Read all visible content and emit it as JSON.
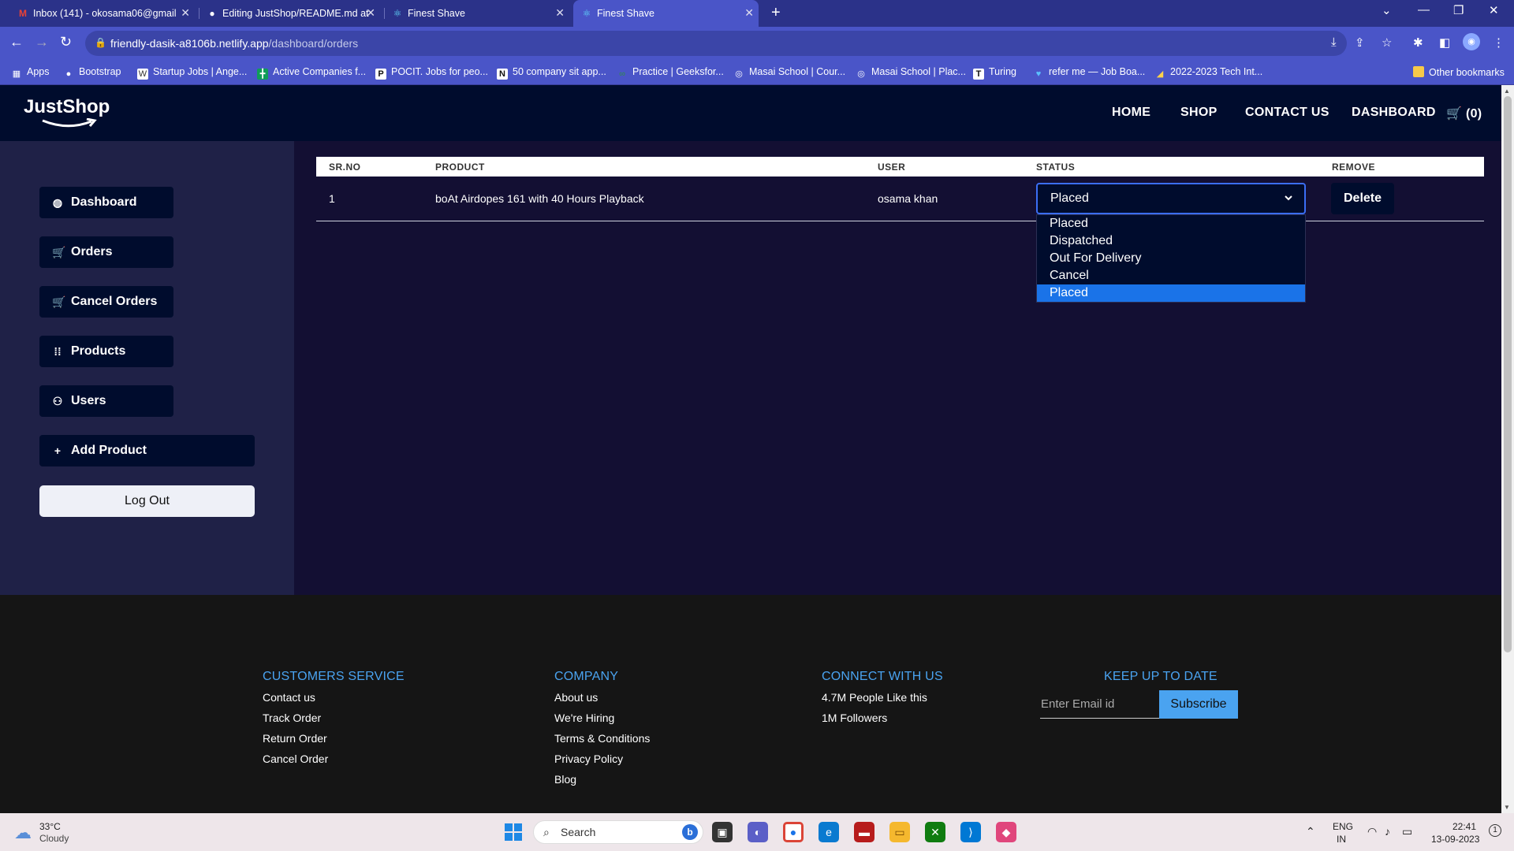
{
  "browser": {
    "tabs": [
      {
        "title": "Inbox (141) - okosama06@gmail",
        "icon": "gmail-icon",
        "color": "#ea4335"
      },
      {
        "title": "Editing JustShop/README.md at",
        "icon": "github-icon",
        "color": "#ffffff"
      },
      {
        "title": "Finest Shave",
        "icon": "react-icon",
        "color": "#61dafb"
      },
      {
        "title": "Finest Shave",
        "icon": "react-icon",
        "color": "#61dafb"
      }
    ],
    "url_host": "friendly-dasik-a8106b.netlify.app",
    "url_path": "/dashboard/orders",
    "bookmarks": [
      {
        "label": "Apps",
        "icon": "apps-grid-icon"
      },
      {
        "label": "Bootstrap",
        "icon": "github-icon"
      },
      {
        "label": "Startup Jobs | Ange...",
        "icon": "startup-icon"
      },
      {
        "label": "Active Companies f...",
        "icon": "spreadsheet-icon"
      },
      {
        "label": "POCIT. Jobs for peo...",
        "icon": "pocit-icon"
      },
      {
        "label": "50 company sit app...",
        "icon": "notion-icon"
      },
      {
        "label": "Practice | Geeksfor...",
        "icon": "geeksforgeeks-icon"
      },
      {
        "label": "Masai School | Cour...",
        "icon": "masai-icon"
      },
      {
        "label": "Masai School | Plac...",
        "icon": "masai-icon"
      },
      {
        "label": "Turing",
        "icon": "turing-icon"
      },
      {
        "label": "refer me — Job Boa...",
        "icon": "referme-icon"
      },
      {
        "label": "2022-2023 Tech Int...",
        "icon": "chart-icon"
      }
    ],
    "other_bookmarks": "Other bookmarks"
  },
  "site": {
    "logo": "JustShop",
    "nav": {
      "home": "HOME",
      "shop": "SHOP",
      "contact": "CONTACT US",
      "dashboard": "DASHBOARD",
      "cart": "(0)"
    }
  },
  "sidebar": {
    "items": [
      {
        "label": "Dashboard",
        "icon": "dashboard-icon"
      },
      {
        "label": "Orders",
        "icon": "cart-icon"
      },
      {
        "label": "Cancel Orders",
        "icon": "cart-icon"
      },
      {
        "label": "Products",
        "icon": "grid-icon"
      },
      {
        "label": "Users",
        "icon": "user-icon"
      },
      {
        "label": "Add Product",
        "icon": "plus-icon"
      }
    ],
    "logout": "Log Out"
  },
  "table": {
    "headers": {
      "srno": "SR.NO",
      "product": "PRODUCT",
      "user": "USER",
      "status": "STATUS",
      "remove": "REMOVE"
    },
    "rows": [
      {
        "srno": "1",
        "product": "boAt Airdopes 161 with 40 Hours Playback",
        "user": "osama khan",
        "status": "Placed",
        "remove": "Delete"
      }
    ],
    "status_options": [
      "Placed",
      "Dispatched",
      "Out For Delivery",
      "Cancel",
      "Placed"
    ]
  },
  "footer": {
    "customer_service": {
      "title": "CUSTOMERS SERVICE",
      "links": [
        "Contact us",
        "Track Order",
        "Return Order",
        "Cancel Order"
      ]
    },
    "company": {
      "title": "COMPANY",
      "links": [
        "About us",
        "We're Hiring",
        "Terms & Conditions",
        "Privacy Policy",
        "Blog"
      ]
    },
    "connect": {
      "title": "CONNECT WITH US",
      "links": [
        "4.7M People Like this",
        "1M Followers"
      ]
    },
    "newsletter": {
      "title": "KEEP UP TO DATE",
      "placeholder": "Enter Email id",
      "button": "Subscribe"
    }
  },
  "taskbar": {
    "temperature": "33°C",
    "weather": "Cloudy",
    "search": "Search",
    "lang_top": "ENG",
    "lang_bottom": "IN",
    "time": "22:41",
    "date": "13-09-2023",
    "notification_count": "1"
  },
  "colors": {
    "header_bg": "#000c2d",
    "sidebar_bg": "#1f2147",
    "main_bg": "#130f33",
    "footer_accent": "#4aa3f0",
    "selected_option": "#1a73e8"
  }
}
